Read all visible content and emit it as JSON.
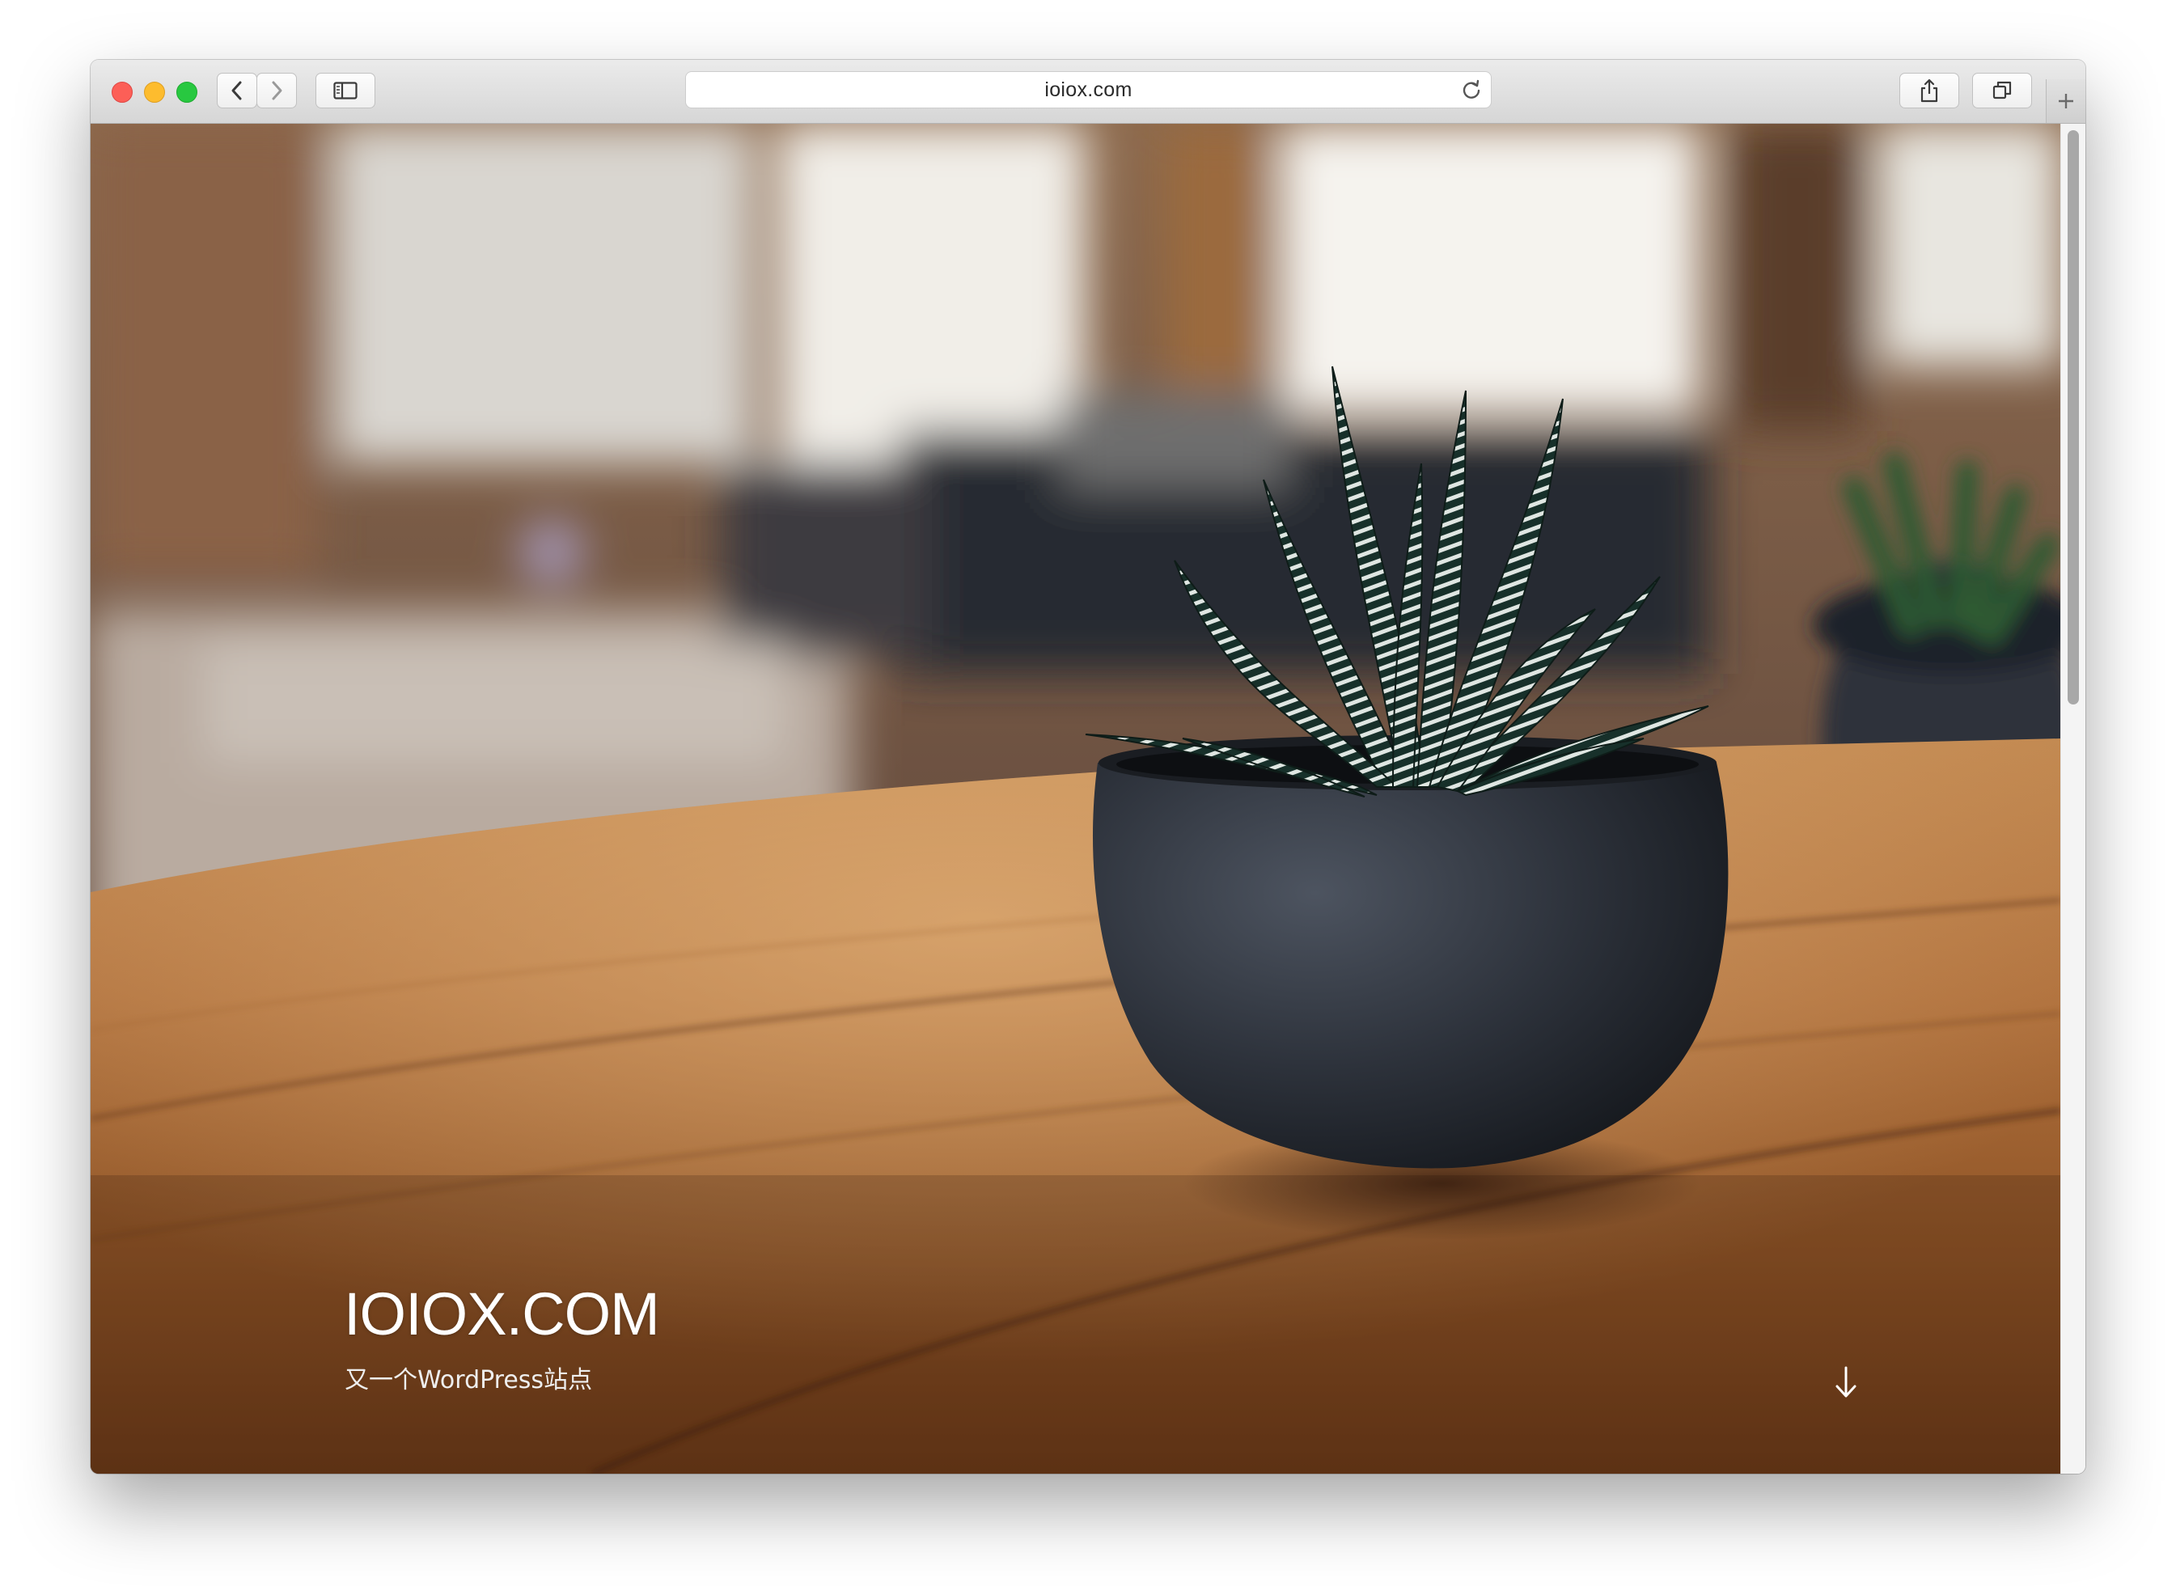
{
  "browser": {
    "url": "ioiox.com",
    "buttons": {
      "close": "close-window",
      "minimize": "minimize-window",
      "zoom": "zoom-window",
      "back": "chevron-left-icon",
      "forward": "chevron-right-icon",
      "sidebar": "sidebar-icon",
      "reload": "reload-icon",
      "share": "share-icon",
      "tabs": "tabs-overview-icon",
      "new_tab": "plus-icon"
    },
    "colors": {
      "close": "#fc5f57",
      "minimize": "#fdbc2e",
      "zoom": "#28c840"
    }
  },
  "hero": {
    "site_title": "IOIOX.COM",
    "tagline": "又一个WordPress站点",
    "scroll_icon": "arrow-down-icon",
    "background_subject": "potted-succulent-on-wooden-table-image"
  }
}
